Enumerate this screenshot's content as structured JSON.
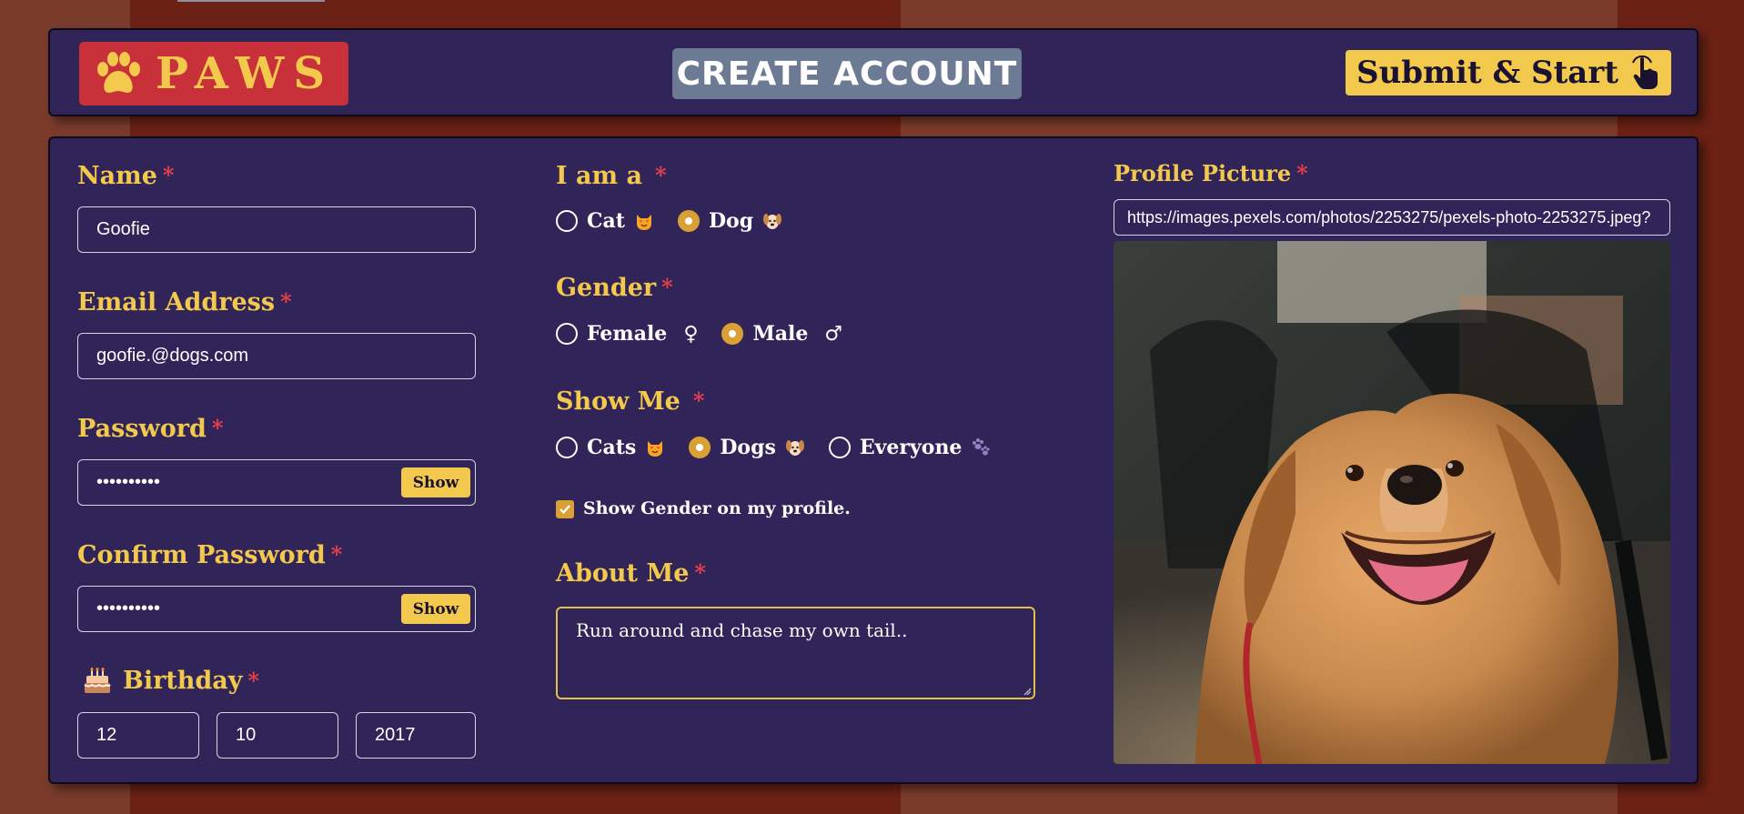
{
  "header": {
    "logo_text": "PAWS",
    "title": "CREATE ACCOUNT",
    "submit_label": "Submit & Start"
  },
  "form": {
    "name": {
      "label": "Name",
      "required": "*",
      "value": "Goofie"
    },
    "email": {
      "label": "Email Address",
      "required": "*",
      "value": "goofie.@dogs.com"
    },
    "password": {
      "label": "Password",
      "required": "*",
      "value": "••••••••••",
      "show_label": "Show"
    },
    "confirm_password": {
      "label": "Confirm Password",
      "required": "*",
      "value": "••••••••••",
      "show_label": "Show"
    },
    "birthday": {
      "label": "Birthday",
      "required": "*",
      "month": "12",
      "day": "10",
      "year": "2017"
    },
    "i_am_a": {
      "label": "I am a",
      "required": "*",
      "options": [
        {
          "label": "Cat",
          "selected": false,
          "icon": "cat-face-emoji"
        },
        {
          "label": "Dog",
          "selected": true,
          "icon": "dog-face-emoji"
        }
      ]
    },
    "gender": {
      "label": "Gender",
      "required": "*",
      "options": [
        {
          "label": "Female",
          "symbol": "♀",
          "selected": false
        },
        {
          "label": "Male",
          "symbol": "♂",
          "selected": true
        }
      ]
    },
    "show_me": {
      "label": "Show Me",
      "required": "*",
      "options": [
        {
          "label": "Cats",
          "selected": false,
          "icon": "cat-face-emoji"
        },
        {
          "label": "Dogs",
          "selected": true,
          "icon": "dog-face-emoji"
        },
        {
          "label": "Everyone",
          "selected": false,
          "icon": "paw-prints-icon"
        }
      ]
    },
    "show_gender": {
      "label": "Show Gender on my profile.",
      "checked": true
    },
    "about_me": {
      "label": "About Me",
      "required": "*",
      "value": "Run around and chase my own tail.."
    },
    "profile_picture": {
      "label": "Profile Picture",
      "required": "*",
      "url": "https://images.pexels.com/photos/2253275/pexels-photo-2253275.jpeg?"
    }
  },
  "colors": {
    "panel": "#312458",
    "accent": "#f2c94c",
    "logo_bg": "#c8303a",
    "title_bg": "#6d7a94",
    "required": "#e8404a",
    "radio_selected": "#d9a035"
  }
}
